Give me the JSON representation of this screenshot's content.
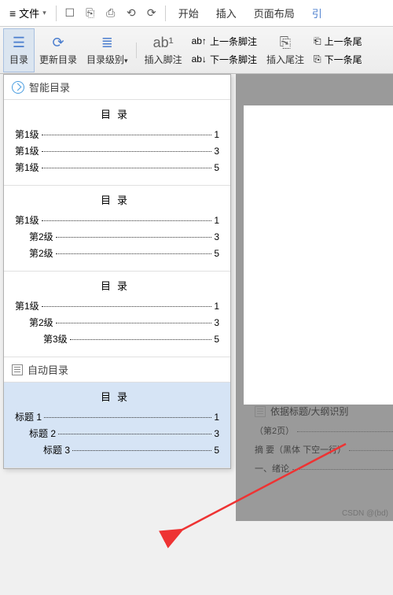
{
  "menubar": {
    "file": "文件",
    "tabs": [
      "开始",
      "插入",
      "页面布局",
      "引"
    ]
  },
  "toolbar": {
    "toc": "目录",
    "update": "更新目录",
    "level": "目录级别",
    "insert_footnote": "插入脚注",
    "prev_footnote": "上一条脚注",
    "next_footnote": "下一条脚注",
    "insert_endnote": "插入尾注",
    "prev_endnote": "上一条尾",
    "next_endnote": "下一条尾"
  },
  "panel": {
    "smart_header": "智能目录",
    "auto_header": "自动目录",
    "toc_title": "目录",
    "previews": [
      {
        "lines": [
          {
            "label": "第1级",
            "page": "1",
            "indent": 0
          },
          {
            "label": "第1级",
            "page": "3",
            "indent": 0
          },
          {
            "label": "第1级",
            "page": "5",
            "indent": 0
          }
        ]
      },
      {
        "lines": [
          {
            "label": "第1级",
            "page": "1",
            "indent": 0
          },
          {
            "label": "第2级",
            "page": "3",
            "indent": 1
          },
          {
            "label": "第2级",
            "page": "5",
            "indent": 1
          }
        ]
      },
      {
        "lines": [
          {
            "label": "第1级",
            "page": "1",
            "indent": 0
          },
          {
            "label": "第2级",
            "page": "3",
            "indent": 1
          },
          {
            "label": "第3级",
            "page": "5",
            "indent": 2
          }
        ]
      }
    ],
    "auto_preview": {
      "lines": [
        {
          "label": "标题 1",
          "page": "1",
          "indent": 0
        },
        {
          "label": "标题 2",
          "page": "3",
          "indent": 1
        },
        {
          "label": "标题 3",
          "page": "5",
          "indent": 2
        }
      ]
    }
  },
  "paper": {
    "header": "依据标题/大纲识别",
    "line1_label": "（第2页）",
    "line2_label": "摘 要（黑体    下空一行）",
    "line3_label": "一、绪论"
  },
  "watermark": "CSDN @(bd)"
}
